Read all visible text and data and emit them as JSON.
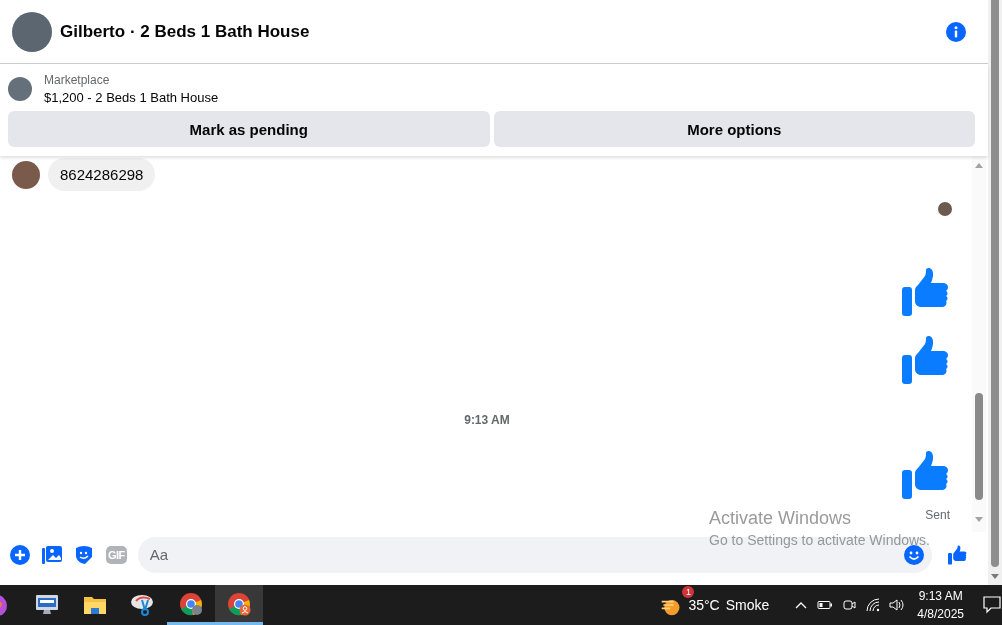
{
  "header": {
    "title": "Gilberto · 2 Beds 1 Bath House"
  },
  "listing": {
    "source": "Marketplace",
    "title": "$1,200 - 2 Beds 1 Bath House",
    "buttons": [
      "Mark as pending",
      "More options"
    ]
  },
  "messages": [
    {
      "kind": "text",
      "text": "8624286298"
    },
    {
      "kind": "read_receipt"
    },
    {
      "kind": "like"
    },
    {
      "kind": "like"
    },
    {
      "kind": "timestamp",
      "text": "9:13 AM"
    },
    {
      "kind": "like",
      "status": "Sent"
    }
  ],
  "composer": {
    "gif_label": "GIF",
    "placeholder": "Aa"
  },
  "activation": {
    "title": "Activate Windows",
    "subtitle": "Go to Settings to activate Windows."
  },
  "taskbar": {
    "apps": [
      {
        "kind": "copilot",
        "running": false,
        "selected": false
      },
      {
        "kind": "remote",
        "running": false,
        "selected": false
      },
      {
        "kind": "folder",
        "running": false,
        "selected": false
      },
      {
        "kind": "snip",
        "running": false,
        "selected": false
      },
      {
        "kind": "browser",
        "running": true,
        "selected": false
      },
      {
        "kind": "browser_profile",
        "running": true,
        "selected": true
      }
    ],
    "weather": {
      "badge": "1",
      "temperature": "35°C",
      "condition": "Smoke"
    },
    "clock": {
      "time": "9:13 AM",
      "date": "4/8/2025"
    }
  }
}
